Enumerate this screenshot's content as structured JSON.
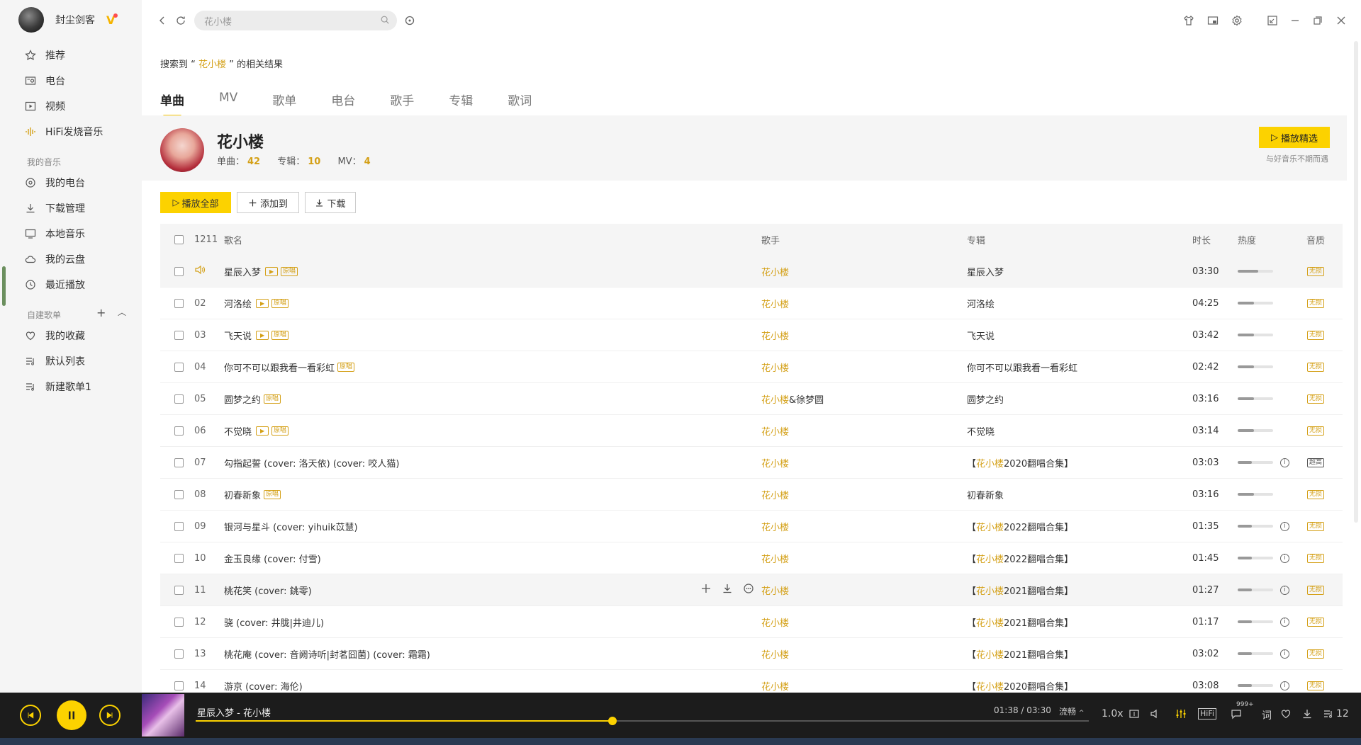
{
  "user": {
    "name": "封尘剑客"
  },
  "sidebar": {
    "top_items": [
      {
        "label": "推荐"
      },
      {
        "label": "电台"
      },
      {
        "label": "视频"
      },
      {
        "label": "HiFi发烧音乐"
      }
    ],
    "my_music_title": "我的音乐",
    "my_music_items": [
      {
        "label": "我的电台"
      },
      {
        "label": "下载管理"
      },
      {
        "label": "本地音乐"
      },
      {
        "label": "我的云盘"
      },
      {
        "label": "最近播放"
      }
    ],
    "playlist_title": "自建歌单",
    "playlist_items": [
      {
        "label": "我的收藏"
      },
      {
        "label": "默认列表"
      },
      {
        "label": "新建歌单1"
      }
    ]
  },
  "search": {
    "value": "花小楼"
  },
  "result": {
    "prefix": "搜索到 “ ",
    "keyword": "花小楼",
    "suffix": " ” 的相关结果"
  },
  "tabs": [
    {
      "label": "单曲",
      "active": true
    },
    {
      "label": "MV"
    },
    {
      "label": "歌单"
    },
    {
      "label": "电台"
    },
    {
      "label": "歌手"
    },
    {
      "label": "专辑"
    },
    {
      "label": "歌词"
    }
  ],
  "artist": {
    "name": "花小楼",
    "singles_label": "单曲：",
    "singles": "42",
    "albums_label": "专辑：",
    "albums": "10",
    "mv_label": "MV：",
    "mv": "4",
    "play_select": "播放精选",
    "play_select_sub": "与好音乐不期而遇"
  },
  "actions": {
    "play_all": "播放全部",
    "add_to": "添加到",
    "download": "下载"
  },
  "table": {
    "headers": {
      "count": "1211",
      "title": "歌名",
      "singer": "歌手",
      "album": "专辑",
      "duration": "时长",
      "heat": "热度",
      "quality": "音质"
    },
    "rows": [
      {
        "num": "",
        "playing": true,
        "title": "星辰入梦",
        "mv": true,
        "orig": "原唱",
        "singer": "花小楼",
        "singer_extra": "",
        "album_pre": "",
        "album_hl": "",
        "album": "星辰入梦",
        "dur": "03:30",
        "heat": 0.58,
        "info": false,
        "q": "无损",
        "hl": true
      },
      {
        "num": "02",
        "title": "河洛绘",
        "mv": true,
        "orig": "原唱",
        "singer": "花小楼",
        "singer_extra": "",
        "album_pre": "",
        "album_hl": "",
        "album": "河洛绘",
        "dur": "04:25",
        "heat": 0.45,
        "info": false,
        "q": "无损"
      },
      {
        "num": "03",
        "title": "飞天说",
        "mv": true,
        "orig": "原唱",
        "singer": "花小楼",
        "singer_extra": "",
        "album_pre": "",
        "album_hl": "",
        "album": "飞天说",
        "dur": "03:42",
        "heat": 0.45,
        "info": false,
        "q": "无损"
      },
      {
        "num": "04",
        "title": "你可不可以跟我看一看彩虹",
        "mv": false,
        "orig": "原唱",
        "singer": "花小楼",
        "singer_extra": "",
        "album_pre": "",
        "album_hl": "",
        "album": "你可不可以跟我看一看彩虹",
        "dur": "02:42",
        "heat": 0.45,
        "info": false,
        "q": "无损"
      },
      {
        "num": "05",
        "title": "圆梦之约",
        "mv": false,
        "orig": "原唱",
        "singer": "花小楼",
        "singer_extra": "&徐梦圆",
        "album_pre": "",
        "album_hl": "",
        "album": "圆梦之约",
        "dur": "03:16",
        "heat": 0.45,
        "info": false,
        "q": "无损"
      },
      {
        "num": "06",
        "title": "不觉晓",
        "mv": true,
        "orig": "原唱",
        "singer": "花小楼",
        "singer_extra": "",
        "album_pre": "",
        "album_hl": "",
        "album": "不觉晓",
        "dur": "03:14",
        "heat": 0.45,
        "info": false,
        "q": "无损"
      },
      {
        "num": "07",
        "title": "勾指起誓 (cover: 洛天依) (cover: 咬人猫)",
        "mv": false,
        "orig": "",
        "singer": "花小楼",
        "singer_extra": "",
        "album_pre": "【",
        "album_hl": "花小楼",
        "album": "2020翻唱合集】",
        "dur": "03:03",
        "heat": 0.4,
        "info": true,
        "q": "超高",
        "qdark": true
      },
      {
        "num": "08",
        "title": "初春新象",
        "mv": false,
        "orig": "原唱",
        "singer": "花小楼",
        "singer_extra": "",
        "album_pre": "",
        "album_hl": "",
        "album": "初春新象",
        "dur": "03:16",
        "heat": 0.45,
        "info": false,
        "q": "无损"
      },
      {
        "num": "09",
        "title": "银河与星斗 (cover: yihuik苡慧)",
        "mv": false,
        "orig": "",
        "singer": "花小楼",
        "singer_extra": "",
        "album_pre": "【",
        "album_hl": "花小楼",
        "album": "2022翻唱合集】",
        "dur": "01:35",
        "heat": 0.4,
        "info": true,
        "q": "无损"
      },
      {
        "num": "10",
        "title": "金玉良缘 (cover: 付雪)",
        "mv": false,
        "orig": "",
        "singer": "花小楼",
        "singer_extra": "",
        "album_pre": "【",
        "album_hl": "花小楼",
        "album": "2022翻唱合集】",
        "dur": "01:45",
        "heat": 0.4,
        "info": true,
        "q": "无损"
      },
      {
        "num": "11",
        "title": "桃花笑 (cover: 銚零)",
        "mv": false,
        "orig": "",
        "singer": "花小楼",
        "singer_extra": "",
        "album_pre": "【",
        "album_hl": "花小楼",
        "album": "2021翻唱合集】",
        "dur": "01:27",
        "heat": 0.4,
        "info": true,
        "q": "无损",
        "hl": true,
        "hover": true
      },
      {
        "num": "12",
        "title": "骁 (cover: 井胧|井迪儿)",
        "mv": false,
        "orig": "",
        "singer": "花小楼",
        "singer_extra": "",
        "album_pre": "【",
        "album_hl": "花小楼",
        "album": "2021翻唱合集】",
        "dur": "01:17",
        "heat": 0.4,
        "info": true,
        "q": "无损"
      },
      {
        "num": "13",
        "title": "桃花庵 (cover: 音阙诗听|封茗囧菌) (cover: 霜霜)",
        "mv": false,
        "orig": "",
        "singer": "花小楼",
        "singer_extra": "",
        "album_pre": "【",
        "album_hl": "花小楼",
        "album": "2021翻唱合集】",
        "dur": "03:02",
        "heat": 0.4,
        "info": true,
        "q": "无损"
      },
      {
        "num": "14",
        "title": "游京 (cover: 海伦)",
        "mv": false,
        "orig": "",
        "singer": "花小楼",
        "singer_extra": "",
        "album_pre": "【",
        "album_hl": "花小楼",
        "album": "2020翻唱合集】",
        "dur": "03:08",
        "heat": 0.4,
        "info": true,
        "q": "无损"
      }
    ]
  },
  "player": {
    "now_playing": "星辰入梦 - 花小楼",
    "time": "01:38 / 03:30",
    "progress": 0.467,
    "fluency": "流畅",
    "speed": "1.0x",
    "hifi": "HiFi",
    "comment_count": "999+",
    "lyric": "词",
    "playlist_count": "12"
  },
  "colors": {
    "accent": "#fcd200",
    "highlight_text": "#d4a017",
    "sidebar_bg": "#f5f5f5",
    "player_bg": "#1c1c1c"
  }
}
